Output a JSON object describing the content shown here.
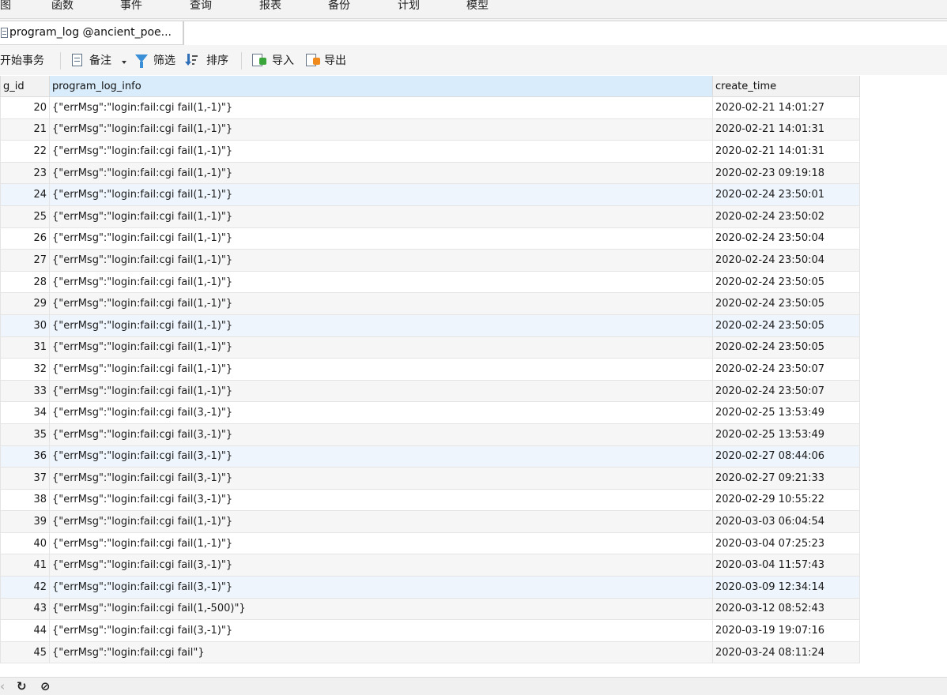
{
  "menu": {
    "items": [
      "图",
      "函数",
      "事件",
      "查询",
      "报表",
      "备份",
      "计划",
      "模型"
    ]
  },
  "tab": {
    "title": "program_log @ancient_poe..."
  },
  "toolbar": {
    "begin_transaction": "开始事务",
    "memo": "备注",
    "filter": "筛选",
    "sort": "排序",
    "import": "导入",
    "export": "导出"
  },
  "grid": {
    "columns": [
      "g_id",
      "program_log_info",
      "create_time"
    ],
    "rows": [
      {
        "id": "20",
        "info": "{\"errMsg\":\"login:fail:cgi fail(1,-1)\"}",
        "time": "2020-02-21 14:01:27"
      },
      {
        "id": "21",
        "info": "{\"errMsg\":\"login:fail:cgi fail(1,-1)\"}",
        "time": "2020-02-21 14:01:31"
      },
      {
        "id": "22",
        "info": "{\"errMsg\":\"login:fail:cgi fail(1,-1)\"}",
        "time": "2020-02-21 14:01:31"
      },
      {
        "id": "23",
        "info": "{\"errMsg\":\"login:fail:cgi fail(1,-1)\"}",
        "time": "2020-02-23 09:19:18"
      },
      {
        "id": "24",
        "info": "{\"errMsg\":\"login:fail:cgi fail(1,-1)\"}",
        "time": "2020-02-24 23:50:01"
      },
      {
        "id": "25",
        "info": "{\"errMsg\":\"login:fail:cgi fail(1,-1)\"}",
        "time": "2020-02-24 23:50:02"
      },
      {
        "id": "26",
        "info": "{\"errMsg\":\"login:fail:cgi fail(1,-1)\"}",
        "time": "2020-02-24 23:50:04"
      },
      {
        "id": "27",
        "info": "{\"errMsg\":\"login:fail:cgi fail(1,-1)\"}",
        "time": "2020-02-24 23:50:04"
      },
      {
        "id": "28",
        "info": "{\"errMsg\":\"login:fail:cgi fail(1,-1)\"}",
        "time": "2020-02-24 23:50:05"
      },
      {
        "id": "29",
        "info": "{\"errMsg\":\"login:fail:cgi fail(1,-1)\"}",
        "time": "2020-02-24 23:50:05"
      },
      {
        "id": "30",
        "info": "{\"errMsg\":\"login:fail:cgi fail(1,-1)\"}",
        "time": "2020-02-24 23:50:05"
      },
      {
        "id": "31",
        "info": "{\"errMsg\":\"login:fail:cgi fail(1,-1)\"}",
        "time": "2020-02-24 23:50:05"
      },
      {
        "id": "32",
        "info": "{\"errMsg\":\"login:fail:cgi fail(1,-1)\"}",
        "time": "2020-02-24 23:50:07"
      },
      {
        "id": "33",
        "info": "{\"errMsg\":\"login:fail:cgi fail(1,-1)\"}",
        "time": "2020-02-24 23:50:07"
      },
      {
        "id": "34",
        "info": "{\"errMsg\":\"login:fail:cgi fail(3,-1)\"}",
        "time": "2020-02-25 13:53:49"
      },
      {
        "id": "35",
        "info": "{\"errMsg\":\"login:fail:cgi fail(3,-1)\"}",
        "time": "2020-02-25 13:53:49"
      },
      {
        "id": "36",
        "info": "{\"errMsg\":\"login:fail:cgi fail(3,-1)\"}",
        "time": "2020-02-27 08:44:06"
      },
      {
        "id": "37",
        "info": "{\"errMsg\":\"login:fail:cgi fail(3,-1)\"}",
        "time": "2020-02-27 09:21:33"
      },
      {
        "id": "38",
        "info": "{\"errMsg\":\"login:fail:cgi fail(3,-1)\"}",
        "time": "2020-02-29 10:55:22"
      },
      {
        "id": "39",
        "info": "{\"errMsg\":\"login:fail:cgi fail(1,-1)\"}",
        "time": "2020-03-03 06:04:54"
      },
      {
        "id": "40",
        "info": "{\"errMsg\":\"login:fail:cgi fail(1,-1)\"}",
        "time": "2020-03-04 07:25:23"
      },
      {
        "id": "41",
        "info": "{\"errMsg\":\"login:fail:cgi fail(3,-1)\"}",
        "time": "2020-03-04 11:57:43"
      },
      {
        "id": "42",
        "info": "{\"errMsg\":\"login:fail:cgi fail(3,-1)\"}",
        "time": "2020-03-09 12:34:14"
      },
      {
        "id": "43",
        "info": "{\"errMsg\":\"login:fail:cgi fail(1,-500)\"}",
        "time": "2020-03-12 08:52:43"
      },
      {
        "id": "44",
        "info": "{\"errMsg\":\"login:fail:cgi fail(3,-1)\"}",
        "time": "2020-03-19 19:07:16"
      },
      {
        "id": "45",
        "info": "{\"errMsg\":\"login:fail:cgi fail\"}",
        "time": "2020-03-24 08:11:24"
      }
    ]
  },
  "statusbar": {
    "prev_icon": "‹",
    "refresh_icon": "↻",
    "stop_icon": "⊘"
  }
}
